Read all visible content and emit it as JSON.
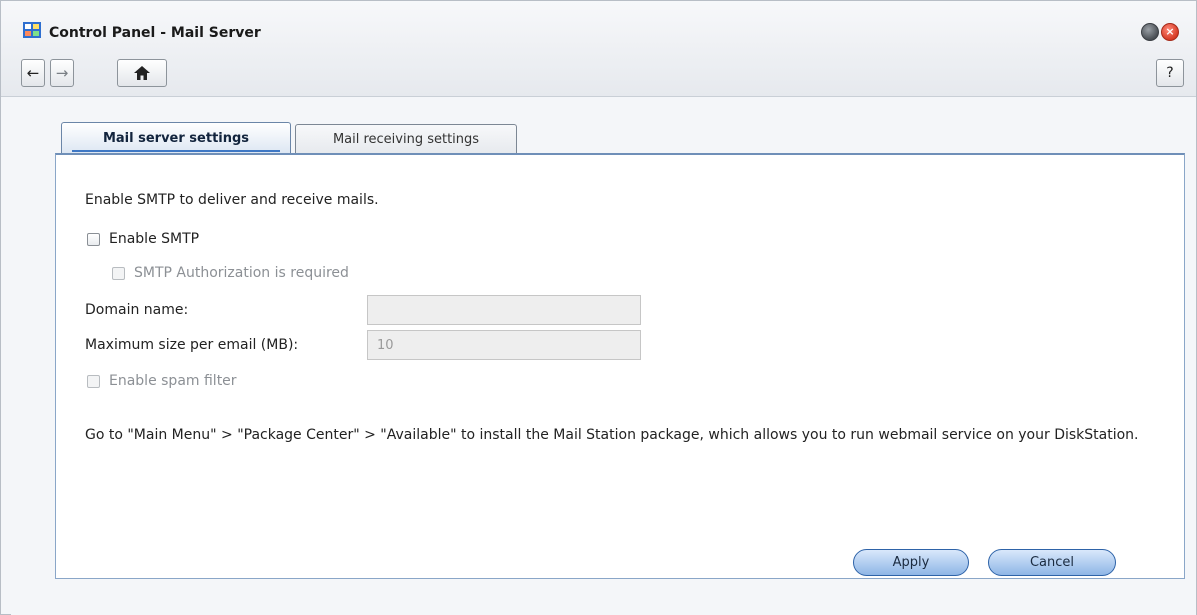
{
  "window": {
    "title": "Control Panel - Mail Server",
    "nav": {
      "back_glyph": "←",
      "forward_glyph": "→",
      "home_glyph": "⌂",
      "help_glyph": "?"
    }
  },
  "tabs": [
    {
      "label": "Mail server settings",
      "active": true
    },
    {
      "label": "Mail receiving settings",
      "active": false
    }
  ],
  "form": {
    "intro": "Enable SMTP to deliver and receive mails.",
    "enable_smtp": {
      "label": "Enable SMTP",
      "checked": false
    },
    "smtp_auth": {
      "label": "SMTP Authorization is required",
      "checked": false,
      "disabled": true
    },
    "domain_name": {
      "label": "Domain name:",
      "value": ""
    },
    "max_size": {
      "label": "Maximum size per email (MB):",
      "value": "10"
    },
    "spam_filter": {
      "label": "Enable spam filter",
      "checked": false,
      "disabled": true
    },
    "note": "Go to \"Main Menu\" > \"Package Center\" > \"Available\" to install the Mail Station package, which allows you to run webmail service on your DiskStation."
  },
  "buttons": {
    "apply": "Apply",
    "cancel": "Cancel"
  },
  "colors": {
    "accent": "#3e78c5",
    "panel_border": "#8aa6c8",
    "close": "#d63a25"
  }
}
